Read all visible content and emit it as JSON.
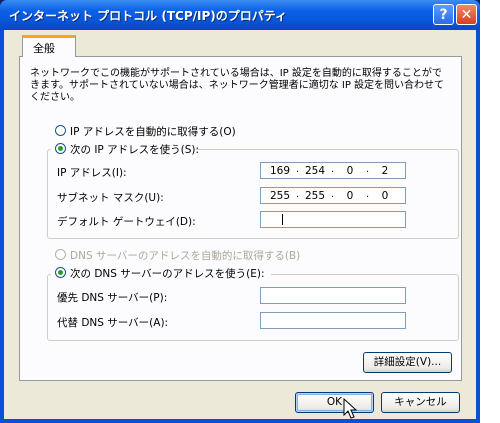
{
  "window": {
    "title": "インターネット プロトコル (TCP/IP)のプロパティ",
    "help_icon": "?",
    "close_icon": "✕"
  },
  "tabs": [
    {
      "label": "全般"
    }
  ],
  "description": "ネットワークでこの機能がサポートされている場合は、IP 設定を自動的に取得することができます。サポートされていない場合は、ネットワーク管理者に適切な IP 設定を問い合わせてください。",
  "ip_mode": {
    "auto_label": "IP アドレスを自動的に取得する(O)",
    "manual_label": "次の IP アドレスを使う(S):",
    "selected": "manual"
  },
  "ip_fields": {
    "ip_label": "IP アドレス(I):",
    "ip_value": [
      "169",
      "254",
      "0",
      "2"
    ],
    "subnet_label": "サブネット マスク(U):",
    "subnet_value": [
      "255",
      "255",
      "0",
      "0"
    ],
    "gateway_label": "デフォルト ゲートウェイ(D):",
    "gateway_value": [
      "",
      "",
      "",
      ""
    ]
  },
  "dns_mode": {
    "auto_label": "DNS サーバーのアドレスを自動的に取得する(B)",
    "manual_label": "次の DNS サーバーのアドレスを使う(E):",
    "selected": "manual"
  },
  "dns_fields": {
    "preferred_label": "優先 DNS サーバー(P):",
    "alternate_label": "代替 DNS サーバー(A):"
  },
  "buttons": {
    "advanced": "詳細設定(V)...",
    "ok": "OK",
    "cancel": "キャンセル"
  }
}
